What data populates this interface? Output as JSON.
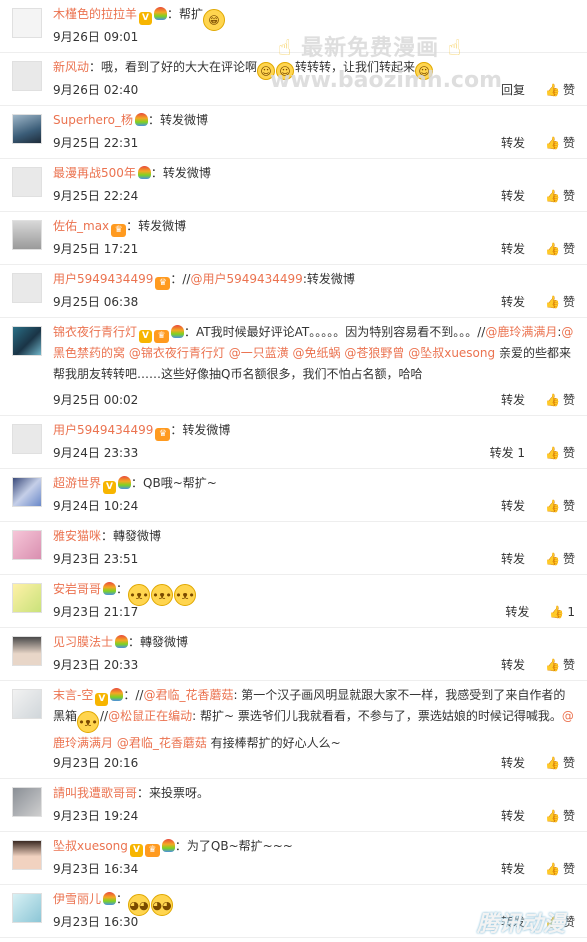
{
  "labels": {
    "forward": "转发",
    "like": "赞"
  },
  "watermark": {
    "line1": "最新免费漫画",
    "line2": "www.baozimh.com",
    "corner": "腾讯动漫"
  },
  "comments": [
    {
      "user": "木槿色的拉拉羊",
      "badges": [
        "v",
        "bulb"
      ],
      "parts": [
        {
          "t": "：帮扩"
        },
        {
          "e": "grin",
          "big": true
        }
      ],
      "time": "9月26日 09:01",
      "forward": "",
      "like": "",
      "avatar": "sheep-avatar"
    },
    {
      "user": "新风动",
      "badges": [],
      "parts": [
        {
          "t": "：哦，看到了好的大大在评论啊"
        },
        {
          "e": "smile"
        },
        {
          "e": "smile"
        },
        {
          "t": "转转转，让我们转起来"
        },
        {
          "e": "smile"
        }
      ],
      "time": "9月26日 02:40",
      "forward": "回复",
      "like": "赞",
      "avatar": "default-avatar"
    },
    {
      "user": "Superhero_杨",
      "badges": [
        "bulb"
      ],
      "parts": [
        {
          "t": "：转发微博"
        }
      ],
      "time": "9月25日 22:31",
      "forward": "转发",
      "like": "赞",
      "avatar": "hero-avatar"
    },
    {
      "user": "最漫再战500年",
      "badges": [
        "bulb"
      ],
      "parts": [
        {
          "t": "：转发微博"
        }
      ],
      "time": "9月25日 22:24",
      "forward": "转发",
      "like": "赞",
      "avatar": "default-avatar"
    },
    {
      "user": "佐佑_max",
      "badges": [
        "vip"
      ],
      "parts": [
        {
          "t": "：转发微博"
        }
      ],
      "time": "9月25日 17:21",
      "forward": "转发",
      "like": "赞",
      "avatar": "sketch-avatar"
    },
    {
      "user": "用户5949434499",
      "badges": [
        "vip"
      ],
      "parts": [
        {
          "t": "：//"
        },
        {
          "m": "@用户5949434499"
        },
        {
          "t": ":转发微博"
        }
      ],
      "time": "9月25日 06:38",
      "forward": "转发",
      "like": "赞",
      "avatar": "default-avatar"
    },
    {
      "user": "锦衣夜行青行灯",
      "badges": [
        "v",
        "vip",
        "bulb"
      ],
      "parts": [
        {
          "t": "：AT我时候最好评论AT。。。。。因为特别容易看不到。。。//"
        },
        {
          "m": "@鹿玲满满月"
        },
        {
          "t": ":"
        },
        {
          "m": "@黑色禁药的窝"
        },
        {
          "t": " "
        },
        {
          "m": "@锦衣夜行青行灯"
        },
        {
          "t": " "
        },
        {
          "m": "@一只蓝潢"
        },
        {
          "t": " "
        },
        {
          "m": "@免纸蜗"
        },
        {
          "t": " "
        },
        {
          "m": "@苍狼野曾"
        },
        {
          "t": " "
        },
        {
          "m": "@坠叔xuesong"
        },
        {
          "t": " 亲爱的些都来帮我朋友转转吧……这些好像抽Q币名额很多，我们不怕占名额，哈哈"
        }
      ],
      "time": "9月25日 00:02",
      "forward": "转发",
      "like": "赞",
      "avatar": "lantern-avatar"
    },
    {
      "user": "用户5949434499",
      "badges": [
        "vip"
      ],
      "parts": [
        {
          "t": "：转发微博"
        }
      ],
      "time": "9月24日 23:33",
      "forward": "转发 1",
      "like": "赞",
      "avatar": "default-avatar"
    },
    {
      "user": "超游世界",
      "badges": [
        "v",
        "bulb"
      ],
      "parts": [
        {
          "t": "：QB哦~帮扩~"
        }
      ],
      "time": "9月24日 10:24",
      "forward": "转发",
      "like": "赞",
      "avatar": "anime-avatar"
    },
    {
      "user": "雅安猫咪",
      "badges": [],
      "parts": [
        {
          "t": "：轉發微博"
        }
      ],
      "time": "9月23日 23:51",
      "forward": "转发",
      "like": "赞",
      "avatar": "cat-avatar"
    },
    {
      "user": "安岩哥哥",
      "badges": [
        "bulb"
      ],
      "parts": [
        {
          "t": "："
        },
        {
          "e": "doge",
          "big": true
        },
        {
          "e": "doge",
          "big": true
        },
        {
          "e": "doge",
          "big": true
        }
      ],
      "time": "9月23日 21:17",
      "forward": "转发",
      "like": "1",
      "avatar": "blonde-avatar"
    },
    {
      "user": "见习膜法士",
      "badges": [
        "bulb"
      ],
      "parts": [
        {
          "t": "：轉發微博"
        }
      ],
      "time": "9月23日 20:33",
      "forward": "转发",
      "like": "赞",
      "avatar": "portrait-avatar"
    },
    {
      "user": "末言-空",
      "badges": [
        "v",
        "bulb"
      ],
      "parts": [
        {
          "t": "：//"
        },
        {
          "m": "@君临_花香蘑菇"
        },
        {
          "t": ": 第一个汉子画风明显就跟大家不一样，我感受到了来自作者的黑箱"
        },
        {
          "e": "doge",
          "big": true
        },
        {
          "t": "//"
        },
        {
          "m": "@松鼠正在编动"
        },
        {
          "t": ": 帮扩~ 票选爷们儿我就看看，不参与了，票选姑娘的时候记得喊我。"
        },
        {
          "m": "@鹿玲满满月"
        },
        {
          "t": " "
        },
        {
          "m": "@君临_花香蘑菇"
        },
        {
          "t": " 有接棒帮扩的好心人么~"
        }
      ],
      "time": "9月23日 20:16",
      "forward": "转发",
      "like": "赞",
      "avatar": "sketch2-avatar"
    },
    {
      "user": "請叫我遭歌哥哥",
      "badges": [],
      "parts": [
        {
          "t": "：来投票呀。"
        }
      ],
      "time": "9月23日 19:24",
      "forward": "转发",
      "like": "赞",
      "avatar": "grey-avatar"
    },
    {
      "user": "坠叔xuesong",
      "badges": [
        "v",
        "vip",
        "bulb"
      ],
      "parts": [
        {
          "t": "：为了QB~帮扩~~~"
        }
      ],
      "time": "9月23日 16:34",
      "forward": "转发",
      "like": "赞",
      "avatar": "couple-avatar"
    },
    {
      "user": "伊雪丽儿",
      "badges": [
        "bulb"
      ],
      "parts": [
        {
          "t": "："
        },
        {
          "e": "cute",
          "big": true
        },
        {
          "e": "cute",
          "big": true
        }
      ],
      "time": "9月23日 16:30",
      "forward": "转发",
      "like": "赞",
      "avatar": "blue-avatar"
    }
  ]
}
